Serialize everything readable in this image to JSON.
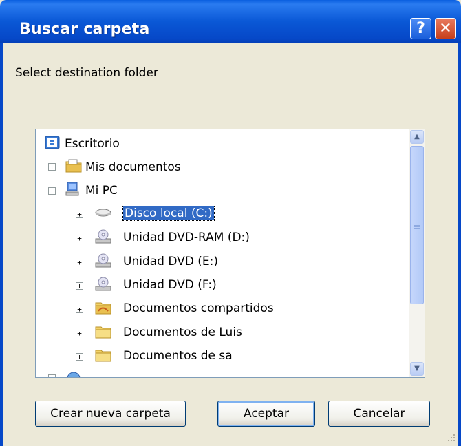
{
  "window": {
    "title": "Buscar carpeta",
    "help_glyph": "?",
    "close_glyph": "✕"
  },
  "prompt": "Select destination folder",
  "tree": {
    "items": [
      {
        "label": "Escritorio",
        "icon": "desktop-icon",
        "expander": "",
        "selected": false
      },
      {
        "label": "Mis documentos",
        "icon": "my-documents-folder-icon",
        "expander": "+",
        "selected": false
      },
      {
        "label": "Mi PC",
        "icon": "my-computer-icon",
        "expander": "−",
        "selected": false
      },
      {
        "label": "Disco local (C:)",
        "icon": "hard-disk-icon",
        "expander": "+",
        "selected": true
      },
      {
        "label": "Unidad DVD-RAM (D:)",
        "icon": "dvd-drive-icon",
        "expander": "+",
        "selected": false
      },
      {
        "label": "Unidad DVD (E:)",
        "icon": "dvd-drive-icon",
        "expander": "+",
        "selected": false
      },
      {
        "label": "Unidad DVD (F:)",
        "icon": "dvd-drive-icon",
        "expander": "+",
        "selected": false
      },
      {
        "label": "Documentos compartidos",
        "icon": "shared-folder-icon",
        "expander": "+",
        "selected": false
      },
      {
        "label": "Documentos de Luis",
        "icon": "folder-icon",
        "expander": "+",
        "selected": false
      },
      {
        "label": "Documentos de sa",
        "icon": "folder-icon",
        "expander": "+",
        "selected": false
      }
    ]
  },
  "buttons": {
    "new_folder": "Crear nueva carpeta",
    "ok": "Aceptar",
    "cancel": "Cancelar"
  },
  "colors": {
    "titlebar": "#0A58D6",
    "selection": "#316AC5",
    "dialog_bg": "#ECE9D8"
  }
}
